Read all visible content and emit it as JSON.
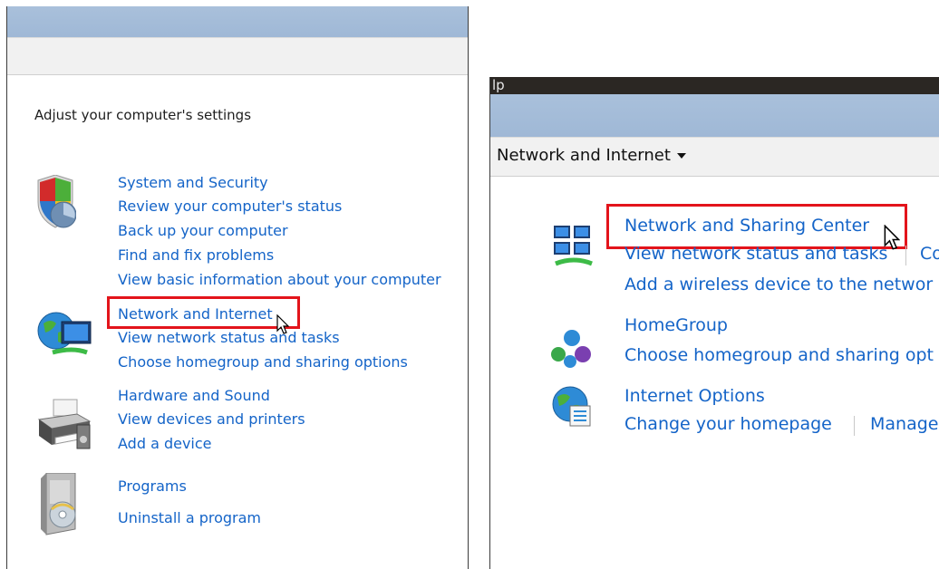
{
  "left": {
    "heading": "Adjust your computer's settings",
    "categories": [
      {
        "title": "System and Security",
        "links": [
          "Review your computer's status",
          "Back up your computer",
          "Find and fix problems",
          "View basic information about your computer"
        ]
      },
      {
        "title": "Network and Internet",
        "links": [
          "View network status and tasks",
          "Choose homegroup and sharing options"
        ]
      },
      {
        "title": "Hardware and Sound",
        "links": [
          "View devices and printers",
          "Add a device"
        ]
      },
      {
        "title": "Programs",
        "links": [
          "Uninstall a program"
        ]
      }
    ]
  },
  "right": {
    "window_fragment": "lp",
    "breadcrumb": "Network and Internet",
    "categories": [
      {
        "title": "Network and Sharing Center",
        "links": [
          "View network status and tasks",
          "Co",
          "Add a wireless device to the networ"
        ]
      },
      {
        "title": "HomeGroup",
        "links": [
          "Choose homegroup and sharing opt"
        ]
      },
      {
        "title": "Internet Options",
        "links": [
          "Change your homepage",
          "Manage"
        ]
      }
    ]
  },
  "colors": {
    "link": "#1464c8",
    "highlight": "#e3141b",
    "titlebar": "#a9c0db"
  },
  "icons": [
    "shield-icon",
    "network-globe-icon",
    "printer-icon",
    "programs-box-icon",
    "network-sharing-icon",
    "homegroup-icon",
    "internet-options-icon",
    "arrow-cursor-icon"
  ]
}
